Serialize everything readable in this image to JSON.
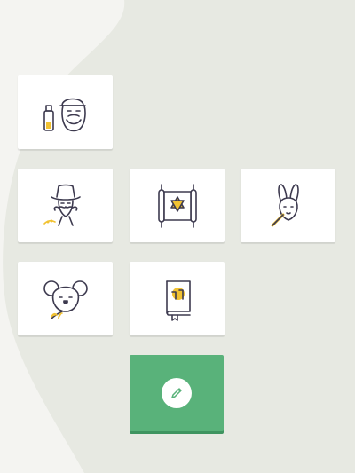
{
  "colors": {
    "page_background": "#f4f4f1",
    "blob_background": "#e7e9e2",
    "card_background": "#ffffff",
    "edit_card": "#59b27a",
    "icon_stroke": "#3d3a4f",
    "icon_accent": "#f1c232"
  },
  "stickers": [
    {
      "icon": "bearded-man-with-bottle-icon"
    },
    {
      "icon": "cowboy-with-mustache-icon"
    },
    {
      "icon": "torah-scroll-star-of-david-icon"
    },
    {
      "icon": "kangaroo-with-wheat-icon"
    },
    {
      "icon": "koala-with-eucalyptus-icon"
    },
    {
      "icon": "hebrew-book-icon"
    }
  ],
  "edit_button": {
    "icon": "pencil-icon"
  }
}
